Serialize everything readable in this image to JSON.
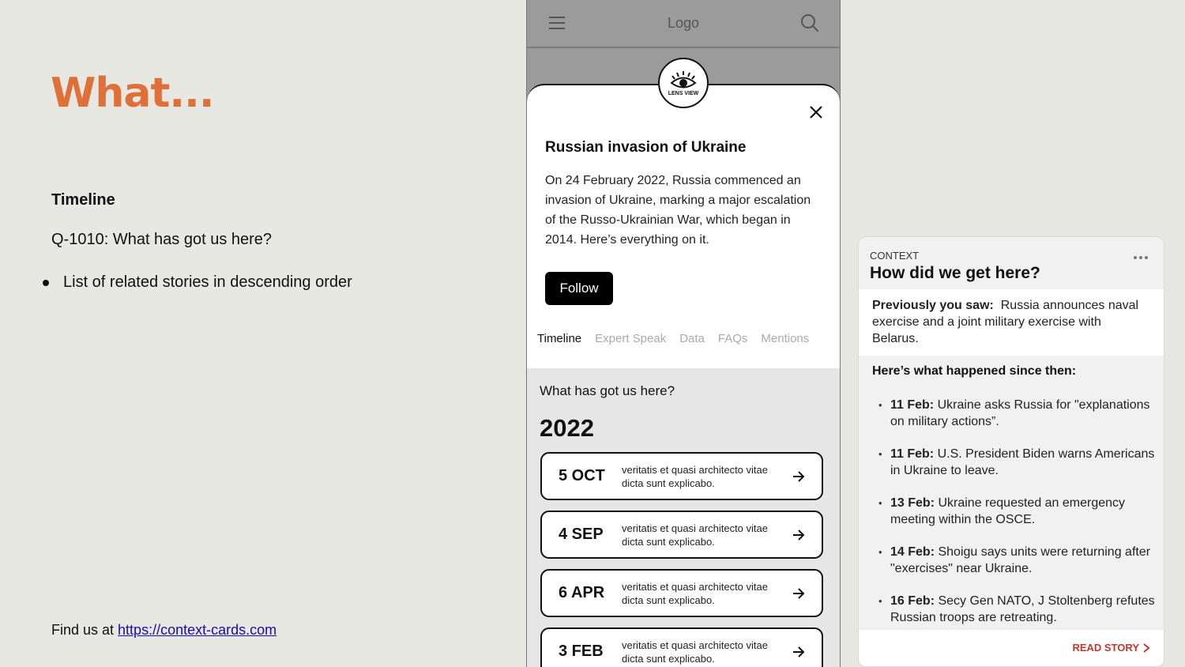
{
  "slide": {
    "title": "What...",
    "section_heading": "Timeline",
    "question": "Q-1010: What has got us here?",
    "bullet": "List of related stories in descending order",
    "footer_prefix": "Find us at ",
    "footer_link": "https://context-cards.com"
  },
  "phone": {
    "header": {
      "logo": "Logo",
      "icons": [
        "hamburger-menu-icon",
        "search-icon"
      ]
    },
    "badge": {
      "icon": "eye-icon",
      "text": "LENS VIEW"
    },
    "sheet": {
      "title": "Russian invasion of Ukraine",
      "description": "On 24 February 2022, Russia commenced an invasion of Ukraine, marking a major escalation of the Russo-Ukrainian War, which began in 2014. Here’s everything on it.",
      "follow_label": "Follow",
      "tabs": [
        {
          "label": "Timeline",
          "active": true
        },
        {
          "label": "Expert Speak",
          "active": false
        },
        {
          "label": "Data",
          "active": false
        },
        {
          "label": "FAQs",
          "active": false
        },
        {
          "label": "Mentions",
          "active": false
        }
      ]
    },
    "timeline": {
      "question": "What has got us here?",
      "year": "2022",
      "items": [
        {
          "date": "5 OCT",
          "text": "veritatis et quasi architecto vitae dicta sunt explicabo."
        },
        {
          "date": "4 SEP",
          "text": "veritatis et quasi architecto vitae dicta sunt explicabo."
        },
        {
          "date": "6 APR",
          "text": "veritatis et quasi architecto vitae dicta sunt explicabo."
        },
        {
          "date": "3 FEB",
          "text": "veritatis et quasi architecto vitae dicta sunt explicabo."
        }
      ]
    }
  },
  "context_card": {
    "label": "CONTEXT",
    "title": "How did we get here?",
    "previously_label": "Previously you saw:",
    "previously_text": "Russia announces naval exercise and a joint military exercise with Belarus.",
    "since_heading": "Here’s what happened since then:",
    "events": [
      {
        "date": "11 Feb:",
        "text": "Ukraine asks Russia for \"explanations on military actions”."
      },
      {
        "date": "11 Feb:",
        "text": "U.S. President Biden warns Americans in Ukraine to leave."
      },
      {
        "date": "13 Feb:",
        "text": "Ukraine requested an emergency meeting within the OSCE."
      },
      {
        "date": "14 Feb:",
        "text": "Shoigu says units were returning after \"exercises\" near Ukraine."
      },
      {
        "date": "16 Feb:",
        "text": "Secy Gen NATO, J Stoltenberg refutes Russian troops are retreating."
      }
    ],
    "read_story": "READ STORY"
  },
  "colors": {
    "accent": "#e0703a",
    "read_story": "#c0392b",
    "link": "#1a0dab"
  }
}
